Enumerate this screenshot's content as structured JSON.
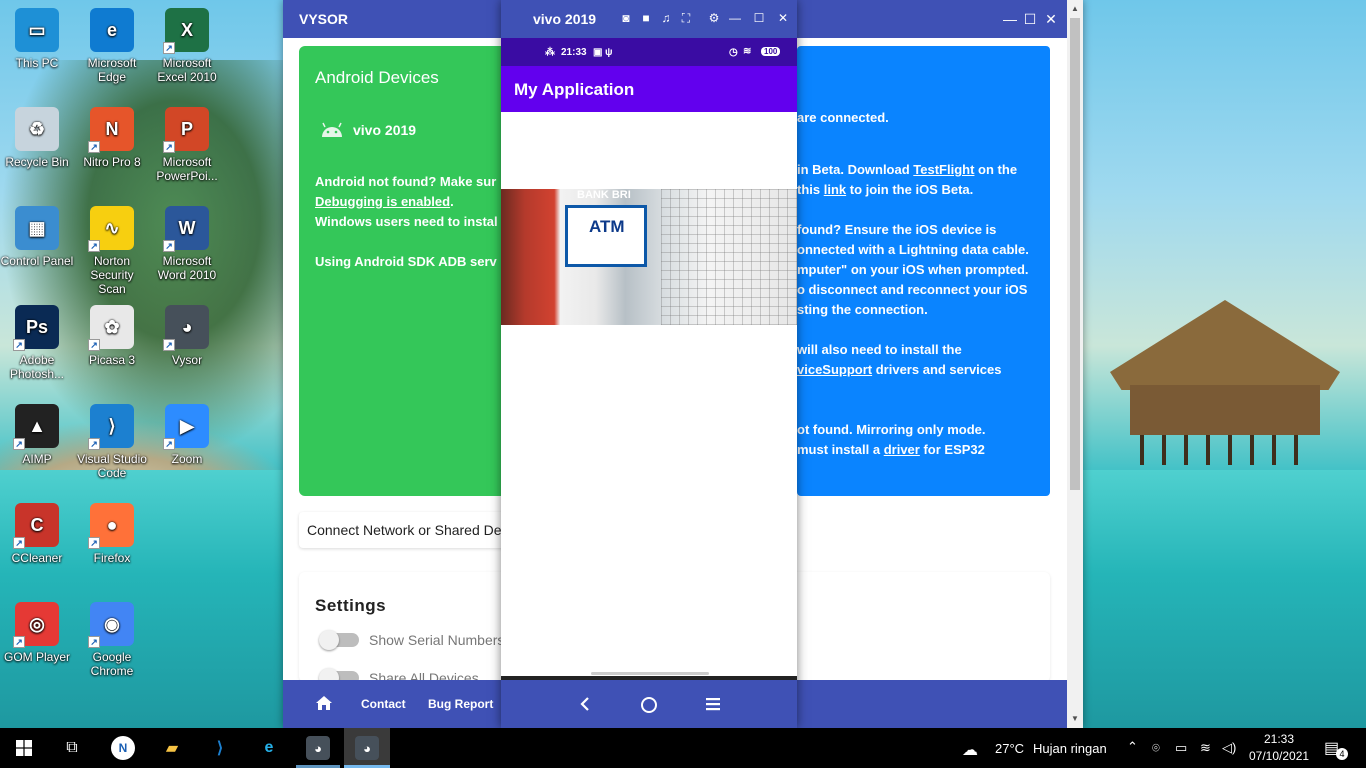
{
  "desktop": {
    "icons": [
      {
        "label": "This PC",
        "icon": "this-pc-icon",
        "color": "#1e90d6",
        "glyph": "▭"
      },
      {
        "label": "Microsoft Edge",
        "icon": "edge-icon",
        "color": "#0f7bd1",
        "glyph": "e"
      },
      {
        "label": "Microsoft Excel 2010",
        "icon": "excel-icon",
        "color": "#1e7145",
        "glyph": "X"
      },
      {
        "label": "Recycle Bin",
        "icon": "recycle-bin-icon",
        "color": "#c7d4dd",
        "glyph": "♻"
      },
      {
        "label": "Nitro Pro 8",
        "icon": "nitro-icon",
        "color": "#e6552a",
        "glyph": "N"
      },
      {
        "label": "Microsoft PowerPoi...",
        "icon": "powerpoint-icon",
        "color": "#d24726",
        "glyph": "P"
      },
      {
        "label": "Control Panel",
        "icon": "control-panel-icon",
        "color": "#3b8dd0",
        "glyph": "▦"
      },
      {
        "label": "Norton Security Scan",
        "icon": "norton-icon",
        "color": "#f7cf10",
        "glyph": "∿"
      },
      {
        "label": "Microsoft Word 2010",
        "icon": "word-icon",
        "color": "#2b579a",
        "glyph": "W"
      },
      {
        "label": "Adobe Photosh...",
        "icon": "photoshop-icon",
        "color": "#0a2a54",
        "glyph": "Ps"
      },
      {
        "label": "Picasa 3",
        "icon": "picasa-icon",
        "color": "#e8e8e8",
        "glyph": "✿"
      },
      {
        "label": "Vysor",
        "icon": "vysor-icon",
        "color": "#46505a",
        "glyph": "◕"
      },
      {
        "label": "AIMP",
        "icon": "aimp-icon",
        "color": "#222222",
        "glyph": "▲"
      },
      {
        "label": "Visual Studio Code",
        "icon": "vscode-icon",
        "color": "#1c80d0",
        "glyph": "⟩"
      },
      {
        "label": "Zoom",
        "icon": "zoom-icon",
        "color": "#2d8cff",
        "glyph": "▶"
      },
      {
        "label": "CCleaner",
        "icon": "ccleaner-icon",
        "color": "#c8342a",
        "glyph": "C"
      },
      {
        "label": "Firefox",
        "icon": "firefox-icon",
        "color": "#ff7139",
        "glyph": "●"
      },
      {
        "label": "GOM Player",
        "icon": "gom-player-icon",
        "color": "#e53935",
        "glyph": "◎"
      },
      {
        "label": "Google Chrome",
        "icon": "chrome-icon",
        "color": "#4285f4",
        "glyph": "◉"
      }
    ]
  },
  "vysor": {
    "title": "VYSOR",
    "android_card": {
      "heading": "Android Devices",
      "device": "vivo 2019",
      "line1": "Android not found? Make sur",
      "line2_link": "Debugging is enabled",
      "line2_tail": ".",
      "line3": "Windows users need to instal",
      "line4": "Using Android SDK ADB serv"
    },
    "ios_card": {
      "l1": "are connected.",
      "l2a": " in Beta. Download ",
      "l2_link": "TestFlight",
      "l2b": " on the",
      "l3a": "this ",
      "l3_link": "link",
      "l3b": " to join the iOS Beta.",
      "l4": "found? Ensure the iOS device is",
      "l5": "onnected with a Lightning data cable.",
      "l6": "mputer\" on your iOS when prompted.",
      "l7": "o disconnect and reconnect your iOS",
      "l8": "sting the connection.",
      "l9": " will also need to install the",
      "l10_link": "viceSupport",
      "l10b": " drivers and services",
      "l11": "ot found. Mirroring only mode.",
      "l12a": "must install a ",
      "l12_link": "driver",
      "l12b": " for ESP32"
    },
    "connect_label": "Connect Network or Shared De",
    "settings": {
      "heading": "Settings",
      "items": [
        "Show Serial Numbers",
        "Share All Devices"
      ]
    },
    "footer": {
      "contact": "Contact",
      "bug_report": "Bug Report"
    }
  },
  "phone": {
    "window_title": "vivo 2019",
    "status_time": "21:33",
    "battery": "100",
    "app_title": "My Application",
    "image_text_bank": "BANK BRI",
    "image_text_atm": "ATM"
  },
  "taskbar": {
    "weather_temp": "27°C",
    "weather_desc": "Hujan ringan",
    "time": "21:33",
    "date": "07/10/2021",
    "notifications": "4"
  },
  "colors": {
    "vysor_blue": "#3f51b5",
    "android_green": "#34c759",
    "ios_blue": "#0a84ff",
    "app_purple": "#6200ee"
  }
}
